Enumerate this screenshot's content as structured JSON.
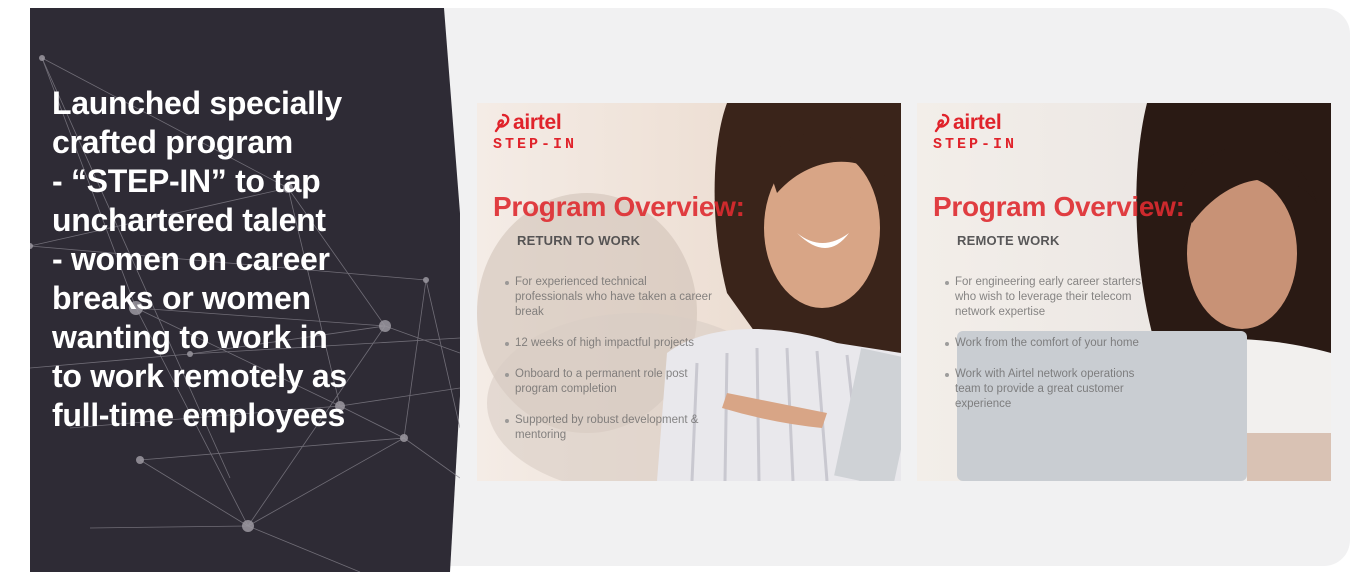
{
  "colors": {
    "panel_dark": "#2e2b35",
    "panel_light": "#f1f1f2",
    "brand_red": "#e0232b",
    "headline_text": "#ffffff"
  },
  "headline": {
    "lines": [
      "Launched specially",
      "crafted program",
      "- “STEP-IN” to tap",
      "unchartered talent",
      "- women on career",
      "breaks or women",
      "wanting to work in",
      "to work remotely as",
      "full-time employees"
    ]
  },
  "cards": [
    {
      "brand": "airtel",
      "program": "STEP-IN",
      "title": "Program Overview:",
      "heading": "RETURN TO WORK",
      "bullets": [
        "For experienced technical professionals who have taken a career break",
        "12 weeks of high impactful projects",
        "Onboard to a permanent role post program completion",
        "Supported by robust development & mentoring"
      ]
    },
    {
      "brand": "airtel",
      "program": "STEP-IN",
      "title": "Program Overview:",
      "heading": "REMOTE WORK",
      "bullets": [
        "For engineering early career starters who wish to leverage their telecom network expertise",
        "Work from the comfort of your home",
        "Work with Airtel network operations team to provide a great customer experience"
      ]
    }
  ]
}
